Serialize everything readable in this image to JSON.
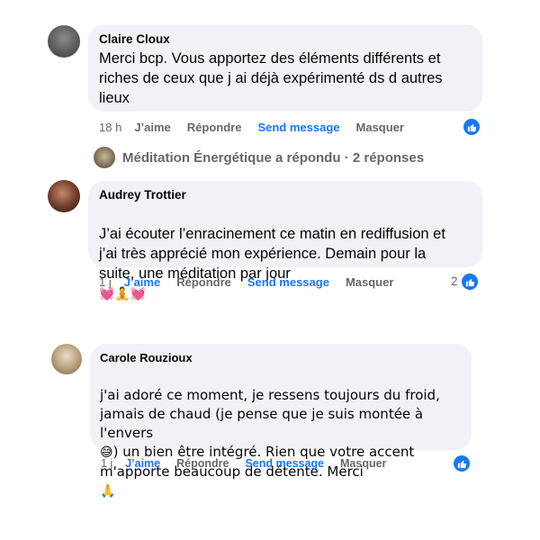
{
  "comments": [
    {
      "author": "Claire Cloux",
      "text": "Merci bcp. Vous apportez des éléments différents et\nriches de ceux que j ai déjà expérimenté ds d autres\nlieux",
      "time": "18 h",
      "like": "J’aime",
      "reply": "Répondre",
      "send": "Send message",
      "hide": "Masquer",
      "reaction_count": ""
    },
    {
      "author": "Audrey Trottier",
      "text": "J’ai écouter l’enracinement ce matin en rediffusion et\nj’ai très apprécié mon expérience. Demain pour la\nsuite, une méditation par jour",
      "emojis": "💓🧘💓",
      "time": "1 j",
      "like": "J’aime",
      "reply": "Répondre",
      "send": "Send message",
      "hide": "Masquer",
      "reaction_count": "2"
    },
    {
      "author": "Carole Rouzioux",
      "text": "j'ai adoré ce moment, je ressens toujours du froid,\njamais de chaud (je pense que je suis montée à\nl'envers",
      "emoji_inline": "😅",
      "text_after": ") un bien être intégré. Rien que votre accent\nm'apporte beaucoup de détente. Merci",
      "emoji_end": "🙏",
      "time": "1 j",
      "like": "J’aime",
      "reply": "Répondre",
      "send": "Send message",
      "hide": "Masquer",
      "reaction_count": ""
    }
  ],
  "replies_line": "Méditation Énergétique a répondu · 2 réponses",
  "colors": {
    "bubble": "#f0f2f5",
    "accent": "#1877f2",
    "muted": "#65676b"
  }
}
